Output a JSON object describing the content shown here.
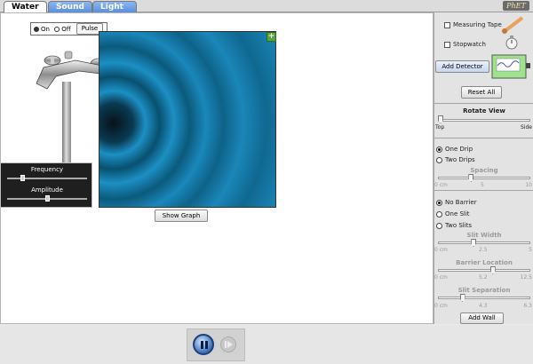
{
  "tabs": [
    {
      "label": "Water",
      "active": true
    },
    {
      "label": "Sound",
      "active": false
    },
    {
      "label": "Light",
      "active": false
    }
  ],
  "logo": "PhET",
  "faucet": {
    "on_label": "On",
    "off_label": "Off",
    "pulse_label": "Pulse",
    "state": "on"
  },
  "source_sliders": {
    "frequency_label": "Frequency",
    "amplitude_label": "Amplitude",
    "frequency_fraction": 0.18,
    "amplitude_fraction": 0.5
  },
  "show_graph_label": "Show Graph",
  "tools": {
    "measuring_tape": "Measuring Tape",
    "stopwatch": "Stopwatch",
    "add_detector": "Add Detector"
  },
  "reset_all_label": "Reset All",
  "rotate_view": {
    "title": "Rotate View",
    "left": "Top",
    "right": "Side",
    "fraction": 0.0
  },
  "drips": {
    "one_label": "One Drip",
    "two_label": "Two Drips",
    "selected": "one",
    "spacing_label": "Spacing",
    "spacing_ticks": [
      "0 cm",
      "5",
      "10"
    ],
    "spacing_fraction": 0.35
  },
  "barrier": {
    "no_barrier": "No Barrier",
    "one_slit": "One Slit",
    "two_slits": "Two Slits",
    "selected": "none",
    "slit_width_label": "Slit Width",
    "slit_width_ticks": [
      "0 cm",
      "2.5",
      "5"
    ],
    "slit_width_fraction": 0.38,
    "barrier_location_label": "Barrier Location",
    "barrier_location_ticks": [
      "0 cm",
      "5.2",
      "12.5"
    ],
    "barrier_location_fraction": 0.6,
    "slit_separation_label": "Slit Separation",
    "slit_separation_ticks": [
      "0 cm",
      "4.3",
      "6.3"
    ],
    "slit_separation_fraction": 0.25
  },
  "add_wall_label": "Add Wall",
  "colors": {
    "wave": "#1c8fc4",
    "tab_inactive": "#5a8fdc",
    "detector_green": "#9fe38f"
  }
}
